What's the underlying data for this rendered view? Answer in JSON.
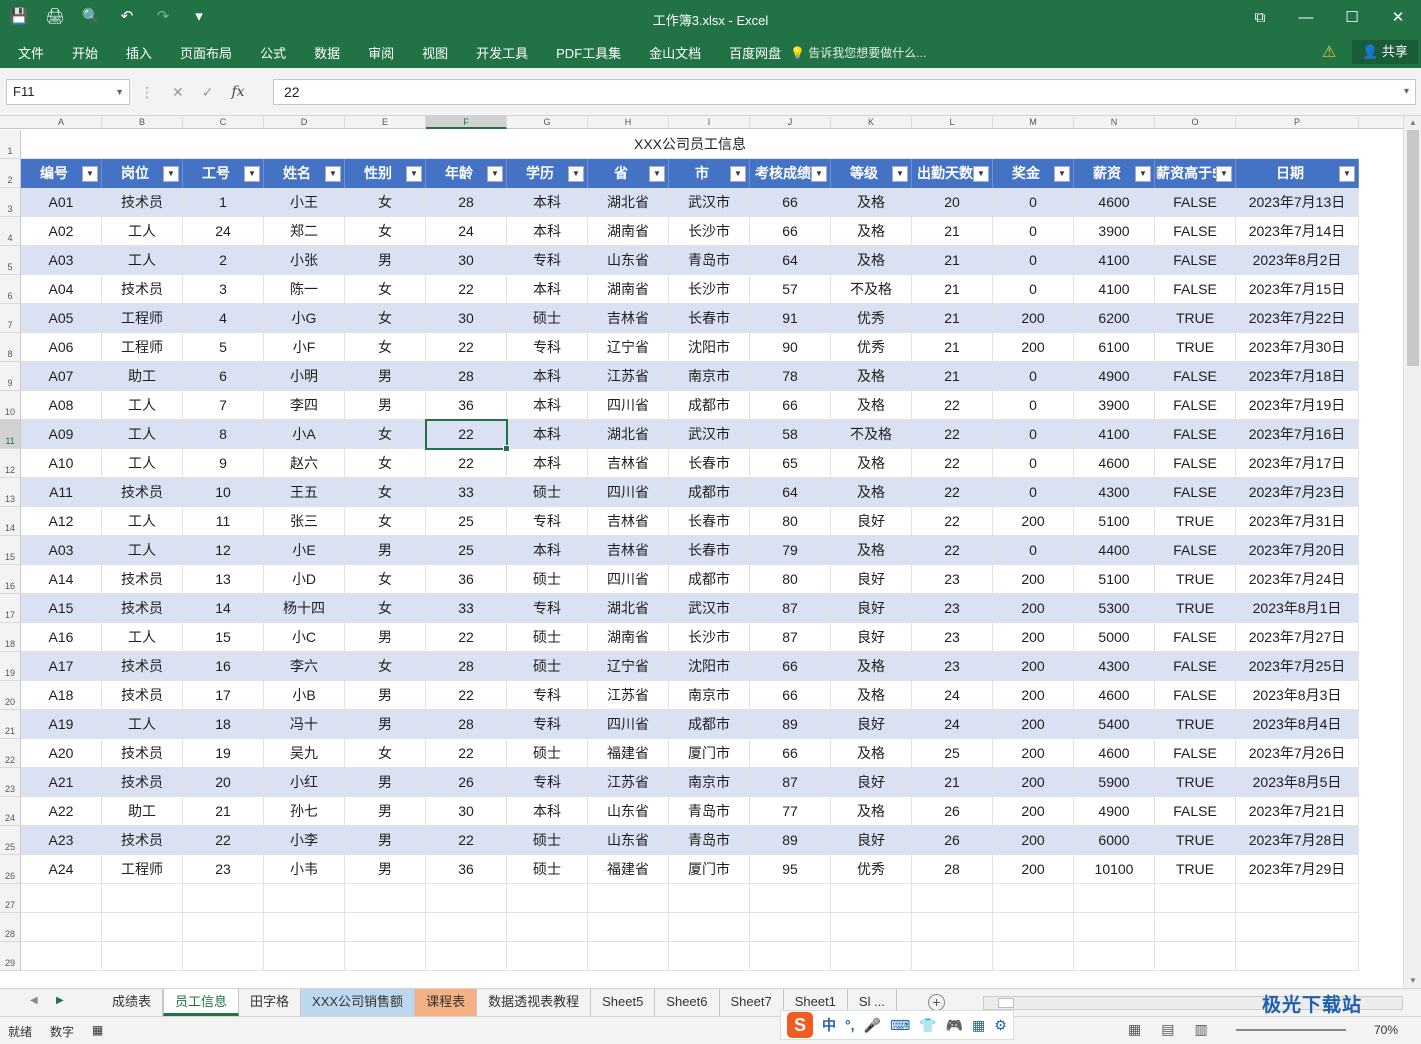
{
  "window": {
    "title": "工作簿3.xlsx - Excel",
    "minimize": "—",
    "maximize": "☐",
    "close": "✕",
    "restore_icon": "⧉"
  },
  "qat": {
    "save": "💾",
    "print_preview": "🖨",
    "find": "🔍",
    "undo": "↶",
    "redo": "↷",
    "customize": "▾"
  },
  "ribbon": {
    "tabs": [
      "文件",
      "开始",
      "插入",
      "页面布局",
      "公式",
      "数据",
      "审阅",
      "视图",
      "开发工具",
      "PDF工具集",
      "金山文档",
      "百度网盘"
    ],
    "tell_me": "告诉我您想要做什么...",
    "share": "共享"
  },
  "formula_bar": {
    "name_box": "F11",
    "cancel": "✕",
    "enter": "✓",
    "fx": "fx",
    "value": "22"
  },
  "columns": [
    "A",
    "B",
    "C",
    "D",
    "E",
    "F",
    "G",
    "H",
    "I",
    "J",
    "K",
    "L",
    "M",
    "N",
    "O",
    "P"
  ],
  "row_numbers": [
    "1",
    "2",
    "3",
    "4",
    "5",
    "6",
    "7",
    "8",
    "9",
    "10",
    "11",
    "12",
    "13",
    "14",
    "15",
    "16",
    "17",
    "18",
    "19",
    "20",
    "21",
    "22",
    "23",
    "24",
    "25",
    "26",
    "27",
    "28",
    "29"
  ],
  "sheet_title": "XXX公司员工信息",
  "headers": [
    "编号",
    "岗位",
    "工号",
    "姓名",
    "性别",
    "年龄",
    "学历",
    "省",
    "市",
    "考核成绩",
    "等级",
    "出勤天数",
    "奖金",
    "薪资",
    "薪资高于5",
    "日期"
  ],
  "rows": [
    [
      "A01",
      "技术员",
      "1",
      "小王",
      "女",
      "28",
      "本科",
      "湖北省",
      "武汉市",
      "66",
      "及格",
      "20",
      "0",
      "4600",
      "FALSE",
      "2023年7月13日"
    ],
    [
      "A02",
      "工人",
      "24",
      "郑二",
      "女",
      "24",
      "本科",
      "湖南省",
      "长沙市",
      "66",
      "及格",
      "21",
      "0",
      "3900",
      "FALSE",
      "2023年7月14日"
    ],
    [
      "A03",
      "工人",
      "2",
      "小张",
      "男",
      "30",
      "专科",
      "山东省",
      "青岛市",
      "64",
      "及格",
      "21",
      "0",
      "4100",
      "FALSE",
      "2023年8月2日"
    ],
    [
      "A04",
      "技术员",
      "3",
      "陈一",
      "女",
      "22",
      "本科",
      "湖南省",
      "长沙市",
      "57",
      "不及格",
      "21",
      "0",
      "4100",
      "FALSE",
      "2023年7月15日"
    ],
    [
      "A05",
      "工程师",
      "4",
      "小G",
      "女",
      "30",
      "硕士",
      "吉林省",
      "长春市",
      "91",
      "优秀",
      "21",
      "200",
      "6200",
      "TRUE",
      "2023年7月22日"
    ],
    [
      "A06",
      "工程师",
      "5",
      "小F",
      "女",
      "22",
      "专科",
      "辽宁省",
      "沈阳市",
      "90",
      "优秀",
      "21",
      "200",
      "6100",
      "TRUE",
      "2023年7月30日"
    ],
    [
      "A07",
      "助工",
      "6",
      "小明",
      "男",
      "28",
      "本科",
      "江苏省",
      "南京市",
      "78",
      "及格",
      "21",
      "0",
      "4900",
      "FALSE",
      "2023年7月18日"
    ],
    [
      "A08",
      "工人",
      "7",
      "李四",
      "男",
      "36",
      "本科",
      "四川省",
      "成都市",
      "66",
      "及格",
      "22",
      "0",
      "3900",
      "FALSE",
      "2023年7月19日"
    ],
    [
      "A09",
      "工人",
      "8",
      "小A",
      "女",
      "22",
      "本科",
      "湖北省",
      "武汉市",
      "58",
      "不及格",
      "22",
      "0",
      "4100",
      "FALSE",
      "2023年7月16日"
    ],
    [
      "A10",
      "工人",
      "9",
      "赵六",
      "女",
      "22",
      "本科",
      "吉林省",
      "长春市",
      "65",
      "及格",
      "22",
      "0",
      "4600",
      "FALSE",
      "2023年7月17日"
    ],
    [
      "A11",
      "技术员",
      "10",
      "王五",
      "女",
      "33",
      "硕士",
      "四川省",
      "成都市",
      "64",
      "及格",
      "22",
      "0",
      "4300",
      "FALSE",
      "2023年7月23日"
    ],
    [
      "A12",
      "工人",
      "11",
      "张三",
      "女",
      "25",
      "专科",
      "吉林省",
      "长春市",
      "80",
      "良好",
      "22",
      "200",
      "5100",
      "TRUE",
      "2023年7月31日"
    ],
    [
      "A03",
      "工人",
      "12",
      "小E",
      "男",
      "25",
      "本科",
      "吉林省",
      "长春市",
      "79",
      "及格",
      "22",
      "0",
      "4400",
      "FALSE",
      "2023年7月20日"
    ],
    [
      "A14",
      "技术员",
      "13",
      "小D",
      "女",
      "36",
      "硕士",
      "四川省",
      "成都市",
      "80",
      "良好",
      "23",
      "200",
      "5100",
      "TRUE",
      "2023年7月24日"
    ],
    [
      "A15",
      "技术员",
      "14",
      "杨十四",
      "女",
      "33",
      "专科",
      "湖北省",
      "武汉市",
      "87",
      "良好",
      "23",
      "200",
      "5300",
      "TRUE",
      "2023年8月1日"
    ],
    [
      "A16",
      "工人",
      "15",
      "小C",
      "男",
      "22",
      "硕士",
      "湖南省",
      "长沙市",
      "87",
      "良好",
      "23",
      "200",
      "5000",
      "FALSE",
      "2023年7月27日"
    ],
    [
      "A17",
      "技术员",
      "16",
      "李六",
      "女",
      "28",
      "硕士",
      "辽宁省",
      "沈阳市",
      "66",
      "及格",
      "23",
      "200",
      "4300",
      "FALSE",
      "2023年7月25日"
    ],
    [
      "A18",
      "技术员",
      "17",
      "小B",
      "男",
      "22",
      "专科",
      "江苏省",
      "南京市",
      "66",
      "及格",
      "24",
      "200",
      "4600",
      "FALSE",
      "2023年8月3日"
    ],
    [
      "A19",
      "工人",
      "18",
      "冯十",
      "男",
      "28",
      "专科",
      "四川省",
      "成都市",
      "89",
      "良好",
      "24",
      "200",
      "5400",
      "TRUE",
      "2023年8月4日"
    ],
    [
      "A20",
      "技术员",
      "19",
      "吴九",
      "女",
      "22",
      "硕士",
      "福建省",
      "厦门市",
      "66",
      "及格",
      "25",
      "200",
      "4600",
      "FALSE",
      "2023年7月26日"
    ],
    [
      "A21",
      "技术员",
      "20",
      "小红",
      "男",
      "26",
      "专科",
      "江苏省",
      "南京市",
      "87",
      "良好",
      "21",
      "200",
      "5900",
      "TRUE",
      "2023年8月5日"
    ],
    [
      "A22",
      "助工",
      "21",
      "孙七",
      "男",
      "30",
      "本科",
      "山东省",
      "青岛市",
      "77",
      "及格",
      "26",
      "200",
      "4900",
      "FALSE",
      "2023年7月21日"
    ],
    [
      "A23",
      "技术员",
      "22",
      "小李",
      "男",
      "22",
      "硕士",
      "山东省",
      "青岛市",
      "89",
      "良好",
      "26",
      "200",
      "6000",
      "TRUE",
      "2023年7月28日"
    ],
    [
      "A24",
      "工程师",
      "23",
      "小韦",
      "男",
      "36",
      "硕士",
      "福建省",
      "厦门市",
      "95",
      "优秀",
      "28",
      "200",
      "10100",
      "TRUE",
      "2023年7月29日"
    ]
  ],
  "sheet_tabs": [
    "成绩表",
    "员工信息",
    "田字格",
    "XXX公司销售额",
    "课程表",
    "数据透视表教程",
    "Sheet5",
    "Sheet6",
    "Sheet7",
    "Sheet1",
    "Sl ..."
  ],
  "active_tab": "员工信息",
  "status": {
    "ready": "就绪",
    "numlock": "数字",
    "zoom": "70%"
  },
  "ime": {
    "lang": "中",
    "items": [
      "°,",
      "🎤",
      "⌨",
      "👕",
      "🎮",
      "▦",
      "⚙"
    ]
  },
  "watermark": "极光下载站",
  "colors": {
    "excel_green": "#217346",
    "header_blue": "#4472c4",
    "band_blue": "#d9e1f2"
  }
}
